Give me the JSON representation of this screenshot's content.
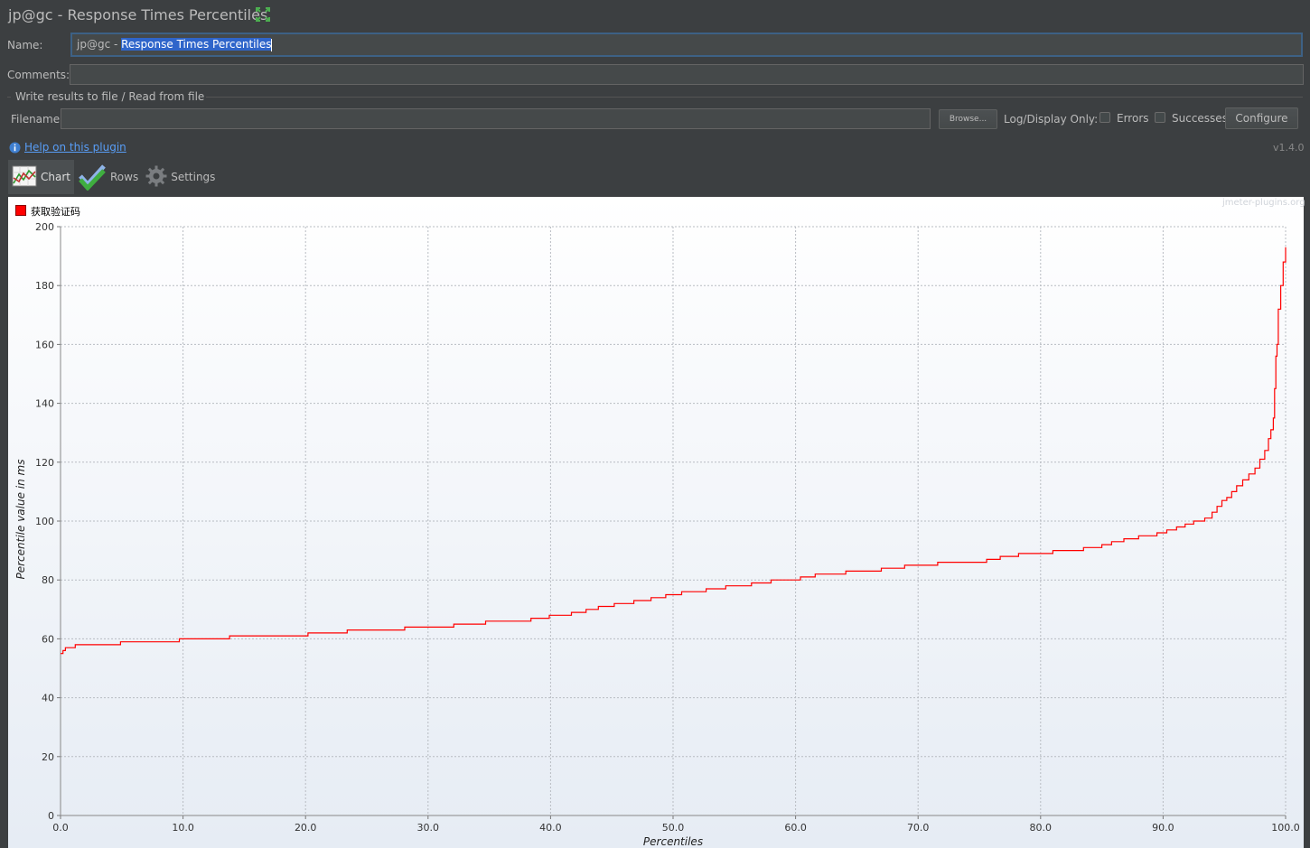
{
  "window": {
    "title": "jp@gc - Response Times Percentiles",
    "version": "v1.4.0"
  },
  "form": {
    "name_label": "Name:",
    "name_prefix": "jp@gc - ",
    "name_selected": "Response Times Percentiles",
    "comments_label": "Comments:",
    "comments_value": "",
    "file_group_title": "Write results to file / Read from file",
    "filename_label": "Filename",
    "filename_value": "",
    "browse_button": "Browse...",
    "log_display_label": "Log/Display Only:",
    "errors_label": "Errors",
    "errors_checked": false,
    "successes_label": "Successes",
    "successes_checked": false,
    "configure_button": "Configure",
    "help_link": "Help on this plugin"
  },
  "tabs": [
    {
      "label": "Chart",
      "icon": "chart-icon",
      "active": true
    },
    {
      "label": "Rows",
      "icon": "checkmarks-icon",
      "active": false
    },
    {
      "label": "Settings",
      "icon": "gear-icon",
      "active": false
    }
  ],
  "chart_watermark": "jmeter-plugins.org",
  "colors": {
    "background": "#3c3f41",
    "series": "#ff0000",
    "link": "#589df6",
    "selection": "#2f65ca"
  },
  "chart_data": {
    "type": "line",
    "xlabel": "Percentiles",
    "ylabel": "Percentile value in ms",
    "xlim": [
      0,
      100
    ],
    "ylim": [
      0,
      200
    ],
    "x_ticks": [
      "0.0",
      "10.0",
      "20.0",
      "30.0",
      "40.0",
      "50.0",
      "60.0",
      "70.0",
      "80.0",
      "90.0",
      "100.0"
    ],
    "y_ticks": [
      "0",
      "20",
      "40",
      "60",
      "80",
      "100",
      "120",
      "140",
      "160",
      "180",
      "200"
    ],
    "grid": true,
    "legend_position": "top-left",
    "series": [
      {
        "name": "获取验证码",
        "color": "#ff0000",
        "points": [
          [
            0.0,
            55
          ],
          [
            0.2,
            56
          ],
          [
            0.4,
            57
          ],
          [
            1.2,
            58
          ],
          [
            4.9,
            59
          ],
          [
            9.7,
            60
          ],
          [
            13.8,
            61
          ],
          [
            20.2,
            62
          ],
          [
            23.4,
            63
          ],
          [
            28.1,
            64
          ],
          [
            32.1,
            65
          ],
          [
            34.7,
            66
          ],
          [
            38.4,
            67
          ],
          [
            39.9,
            68
          ],
          [
            41.7,
            69
          ],
          [
            42.9,
            70
          ],
          [
            43.9,
            71
          ],
          [
            45.2,
            72
          ],
          [
            46.8,
            73
          ],
          [
            48.2,
            74
          ],
          [
            49.4,
            75
          ],
          [
            50.7,
            76
          ],
          [
            52.7,
            77
          ],
          [
            54.3,
            78
          ],
          [
            56.4,
            79
          ],
          [
            58.0,
            80
          ],
          [
            60.4,
            81
          ],
          [
            61.6,
            82
          ],
          [
            64.1,
            83
          ],
          [
            67.0,
            84
          ],
          [
            68.9,
            85
          ],
          [
            71.6,
            86
          ],
          [
            75.6,
            87
          ],
          [
            76.7,
            88
          ],
          [
            78.2,
            89
          ],
          [
            81.0,
            90
          ],
          [
            83.5,
            91
          ],
          [
            85.0,
            92
          ],
          [
            85.8,
            93
          ],
          [
            86.8,
            94
          ],
          [
            88.0,
            95
          ],
          [
            89.5,
            96
          ],
          [
            90.3,
            97
          ],
          [
            91.1,
            98
          ],
          [
            91.8,
            99
          ],
          [
            92.5,
            100
          ],
          [
            93.4,
            101
          ],
          [
            94.0,
            103
          ],
          [
            94.4,
            105
          ],
          [
            94.8,
            107
          ],
          [
            95.2,
            108
          ],
          [
            95.6,
            110
          ],
          [
            96.0,
            112
          ],
          [
            96.5,
            114
          ],
          [
            97.0,
            116
          ],
          [
            97.5,
            118
          ],
          [
            97.9,
            121
          ],
          [
            98.3,
            124
          ],
          [
            98.6,
            128
          ],
          [
            98.8,
            131
          ],
          [
            99.0,
            135
          ],
          [
            99.1,
            145
          ],
          [
            99.2,
            156
          ],
          [
            99.3,
            160
          ],
          [
            99.4,
            172
          ],
          [
            99.6,
            180
          ],
          [
            99.8,
            188
          ],
          [
            100.0,
            193
          ]
        ]
      }
    ]
  }
}
